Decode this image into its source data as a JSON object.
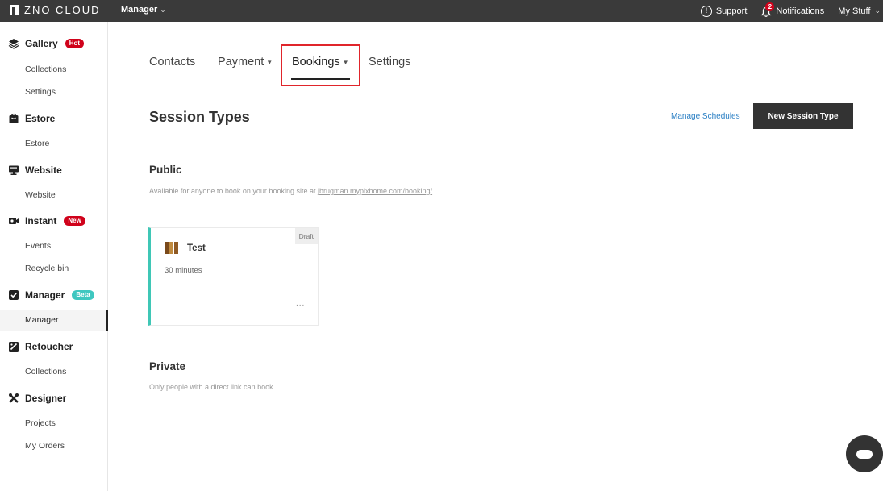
{
  "topbar": {
    "logo": "ZNO CLOUD",
    "app_menu": "Manager",
    "support": "Support",
    "notifications": "Notifications",
    "notifications_count": "2",
    "my_stuff": "My Stuff"
  },
  "sidebar": {
    "gallery": "Gallery",
    "gallery_badge": "Hot",
    "gallery_collections": "Collections",
    "gallery_settings": "Settings",
    "estore": "Estore",
    "estore_sub": "Estore",
    "website": "Website",
    "website_sub": "Website",
    "instant": "Instant",
    "instant_badge": "New",
    "instant_events": "Events",
    "instant_recycle": "Recycle bin",
    "manager": "Manager",
    "manager_badge": "Beta",
    "manager_sub": "Manager",
    "retoucher": "Retoucher",
    "retoucher_collections": "Collections",
    "designer": "Designer",
    "designer_projects": "Projects",
    "designer_orders": "My Orders"
  },
  "tabs": {
    "contacts": "Contacts",
    "payment": "Payment",
    "bookings": "Bookings",
    "settings": "Settings"
  },
  "main": {
    "title": "Session Types",
    "manage_schedules": "Manage Schedules",
    "new_session_type": "New Session Type",
    "public_title": "Public",
    "public_desc": "Available for anyone to book on your booking site at ",
    "public_link": "jbrugman.mypixhome.com/booking/",
    "private_title": "Private",
    "private_desc": "Only people with a direct link can book."
  },
  "card": {
    "status": "Draft",
    "name": "Test",
    "duration": "30 minutes",
    "more": "..."
  },
  "colors": {
    "topbar_bg": "#3a3a3a",
    "accent_teal": "#3fc7b6",
    "badge_red": "#d0021b",
    "link_blue": "#2a7fc4",
    "highlight_red": "#e0252b"
  }
}
